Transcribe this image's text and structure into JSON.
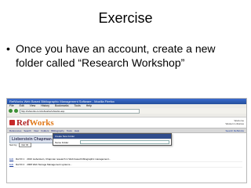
{
  "slide": {
    "title": "Exercise",
    "bullet_symbol": "•",
    "bullet_text": "Once you have an account, create a new folder called “Research Workshop”"
  },
  "screenshot": {
    "window_title": "RefWorks Web Based Bibliographic Management Software - Mozilla Firefox",
    "menu": [
      "File",
      "Edit",
      "View",
      "History",
      "Bookmarks",
      "Tools",
      "Help"
    ],
    "url": "http://refworks.com/refworks/refworks.asp",
    "logo": {
      "ref": "Ref",
      "works": "Works"
    },
    "header_right": {
      "welcome": "Welcome",
      "library": "Western Libraries"
    },
    "nav": {
      "items": [
        "References",
        "Search",
        "View",
        "Folders",
        "Bibliography",
        "Tools",
        "Help"
      ],
      "search_refworks": "Search RefWorks"
    },
    "heading": "Lieberstein Chapman F...",
    "dropdown_label": "Sort by",
    "dropdown_value": "Ref ID",
    "popup": {
      "title": "Create New Folder",
      "label": "Name Folder"
    },
    "refs": [
      {
        "action": "Edit",
        "id": "Ref ID 1",
        "text": "2010 Lieberstein, Chapman research in Web based bibliographic management..."
      },
      {
        "action": "Edit",
        "id": "Ref ID 2",
        "text": "2008 Web Storage Management systems..."
      }
    ]
  },
  "colors": {
    "logo_red": "#b02020",
    "logo_orange": "#e07818",
    "title_bar": "#244f9a"
  }
}
